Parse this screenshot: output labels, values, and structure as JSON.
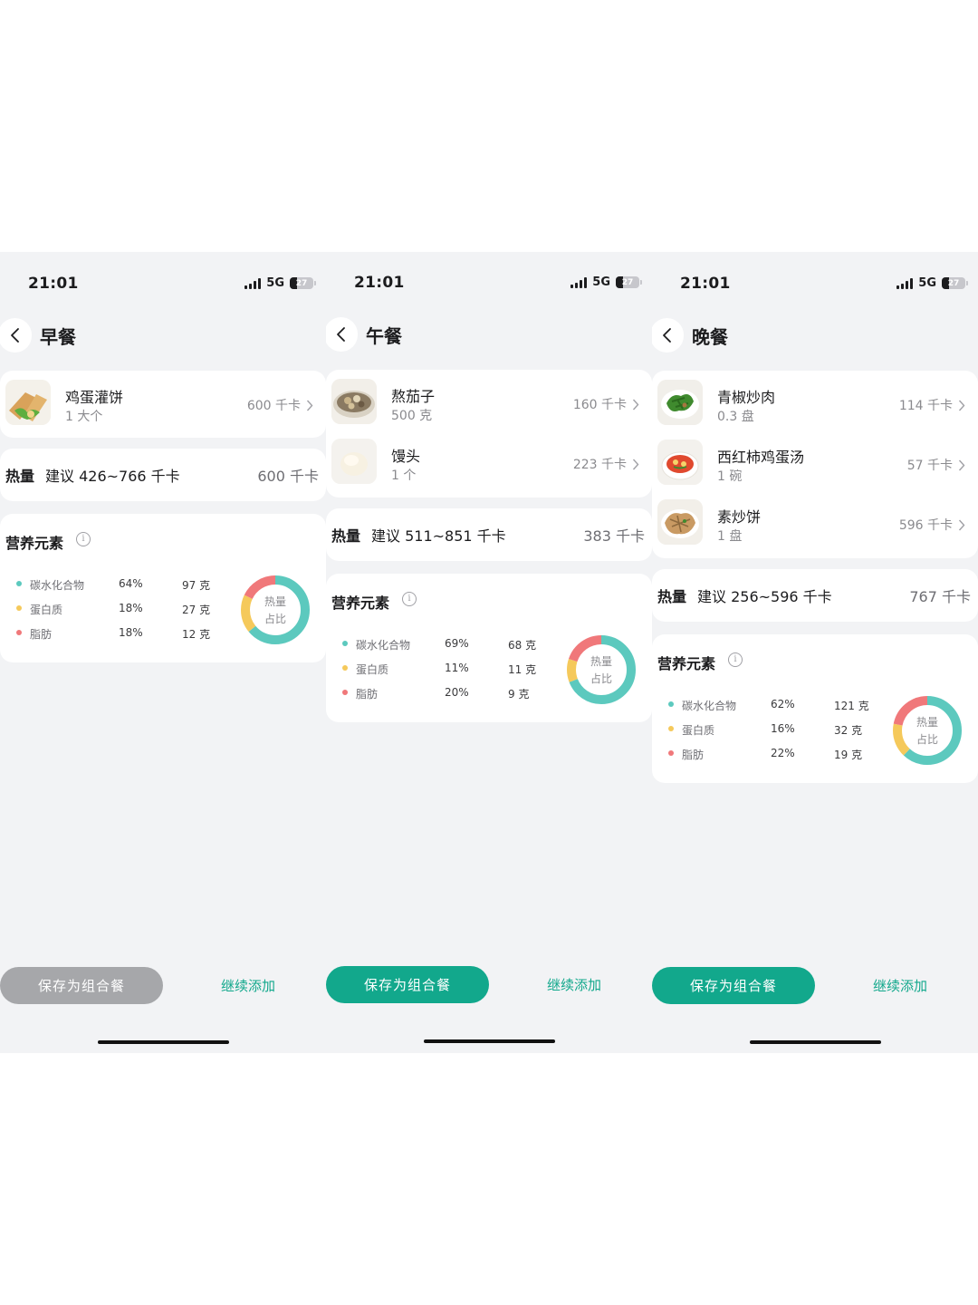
{
  "colors": {
    "accent": "#12a88c",
    "carb": "#5cc9be",
    "protein": "#f5c95b",
    "fat": "#f0787a",
    "disabled": "#a6a7aa"
  },
  "screens": [
    {
      "status": {
        "time": "21:01",
        "network": "5G",
        "battery": "27"
      },
      "title": "早餐",
      "foods": [
        {
          "name": "鸡蛋灌饼",
          "qty": "1 大个",
          "kcal": "600 千卡",
          "icon": "egg-pancake-thumbnail"
        }
      ],
      "calories": {
        "label": "热量",
        "suggest": "建议 426~766 千卡",
        "value": "600 千卡"
      },
      "nutrition": {
        "title": "营养元素",
        "items": [
          {
            "name": "碳水化合物",
            "pct": "64%",
            "grams": "97 克",
            "percent": 64
          },
          {
            "name": "蛋白质",
            "pct": "18%",
            "grams": "27 克",
            "percent": 18
          },
          {
            "name": "脂肪",
            "pct": "18%",
            "grams": "12 克",
            "percent": 18
          }
        ],
        "donut_line1": "热量",
        "donut_line2": "占比"
      },
      "save_label": "保存为组合餐",
      "save_enabled": false,
      "continue_label": "继续添加"
    },
    {
      "status": {
        "time": "21:01",
        "network": "5G",
        "battery": "27"
      },
      "title": "午餐",
      "foods": [
        {
          "name": "熬茄子",
          "qty": "500 克",
          "kcal": "160 千卡",
          "icon": "eggplant-stew-thumbnail"
        },
        {
          "name": "馒头",
          "qty": "1 个",
          "kcal": "223 千卡",
          "icon": "steamed-bun-thumbnail"
        }
      ],
      "calories": {
        "label": "热量",
        "suggest": "建议 511~851 千卡",
        "value": "383 千卡"
      },
      "nutrition": {
        "title": "营养元素",
        "items": [
          {
            "name": "碳水化合物",
            "pct": "69%",
            "grams": "68 克",
            "percent": 69
          },
          {
            "name": "蛋白质",
            "pct": "11%",
            "grams": "11 克",
            "percent": 11
          },
          {
            "name": "脂肪",
            "pct": "20%",
            "grams": "9 克",
            "percent": 20
          }
        ],
        "donut_line1": "热量",
        "donut_line2": "占比"
      },
      "save_label": "保存为组合餐",
      "save_enabled": true,
      "continue_label": "继续添加"
    },
    {
      "status": {
        "time": "21:01",
        "network": "5G",
        "battery": "27"
      },
      "title": "晚餐",
      "foods": [
        {
          "name": "青椒炒肉",
          "qty": "0.3 盘",
          "kcal": "114 千卡",
          "icon": "pepper-pork-thumbnail"
        },
        {
          "name": "西红柿鸡蛋汤",
          "qty": "1 碗",
          "kcal": "57 千卡",
          "icon": "tomato-egg-soup-thumbnail"
        },
        {
          "name": "素炒饼",
          "qty": "1 盘",
          "kcal": "596 千卡",
          "icon": "fried-pancake-thumbnail"
        }
      ],
      "calories": {
        "label": "热量",
        "suggest": "建议 256~596 千卡",
        "value": "767 千卡"
      },
      "nutrition": {
        "title": "营养元素",
        "items": [
          {
            "name": "碳水化合物",
            "pct": "62%",
            "grams": "121 克",
            "percent": 62
          },
          {
            "name": "蛋白质",
            "pct": "16%",
            "grams": "32 克",
            "percent": 16
          },
          {
            "name": "脂肪",
            "pct": "22%",
            "grams": "19 克",
            "percent": 22
          }
        ],
        "donut_line1": "热量",
        "donut_line2": "占比"
      },
      "save_label": "保存为组合餐",
      "save_enabled": true,
      "continue_label": "继续添加"
    }
  ]
}
